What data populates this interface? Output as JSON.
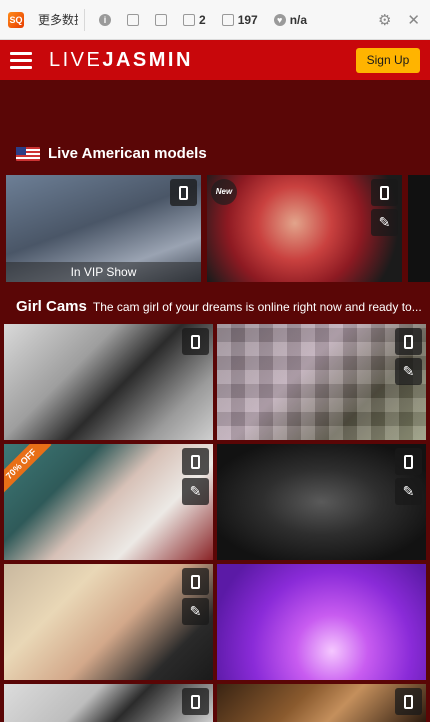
{
  "seo_bar": {
    "title_text": "更多数据",
    "count_links": "2",
    "count_pages": "197",
    "count_rank": "n/a"
  },
  "header": {
    "logo_light": "LIVE",
    "logo_bold": "JASMIN",
    "signup_label": "Sign Up"
  },
  "sections": {
    "american": {
      "title": "Live American models",
      "vip_label": "In VIP Show",
      "new_label": "New"
    },
    "girl_cams": {
      "title": "Girl Cams",
      "subtitle": "The cam girl of your dreams is online right now and ready to..."
    }
  },
  "tiles": {
    "discount_label": "70% OFF"
  },
  "colors": {
    "page_bg": "#5a0606",
    "header_bg": "#c8070b",
    "signup_bg": "#ffb400",
    "discount_bg": "#e86f17"
  }
}
